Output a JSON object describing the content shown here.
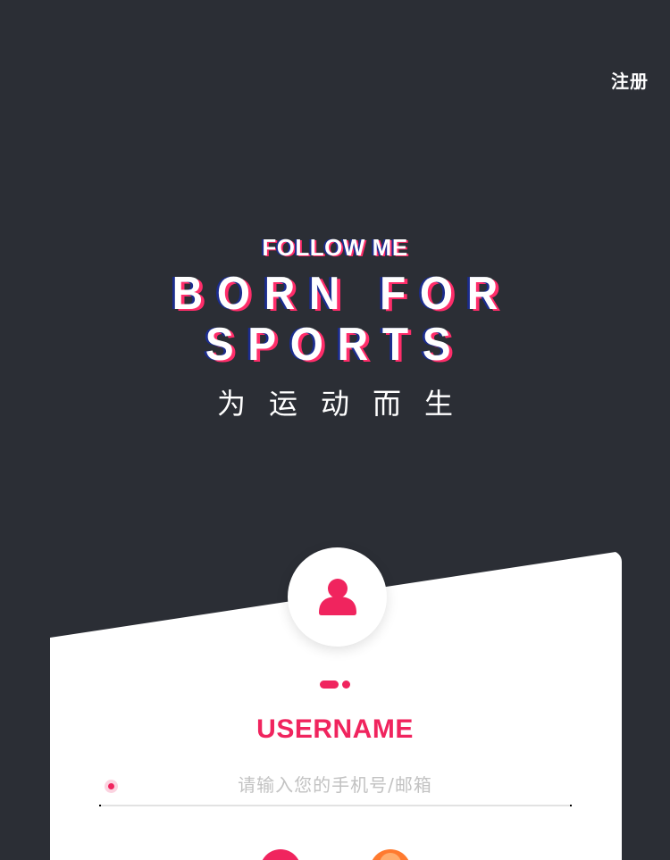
{
  "header": {
    "register_label": "注册"
  },
  "hero": {
    "subtitle": "FOLLOW ME",
    "title": "BORN FOR SPORTS",
    "tagline_cn": "为运动而生"
  },
  "login_card": {
    "field_title": "USERNAME",
    "username_placeholder": "请输入您的手机号/邮箱",
    "username_value": "",
    "page_indicator": {
      "count": 2,
      "active": 0
    }
  },
  "icons": {
    "avatar": "user-icon",
    "social_login_1": "social-login-icon",
    "social_login_2": "social-login-icon"
  },
  "colors": {
    "background": "#2b2e35",
    "accent": "#f0245e",
    "title_shadow_blue": "#1b2c8f",
    "social_orange": "#ff7a2f",
    "placeholder": "#c2c2c2"
  }
}
